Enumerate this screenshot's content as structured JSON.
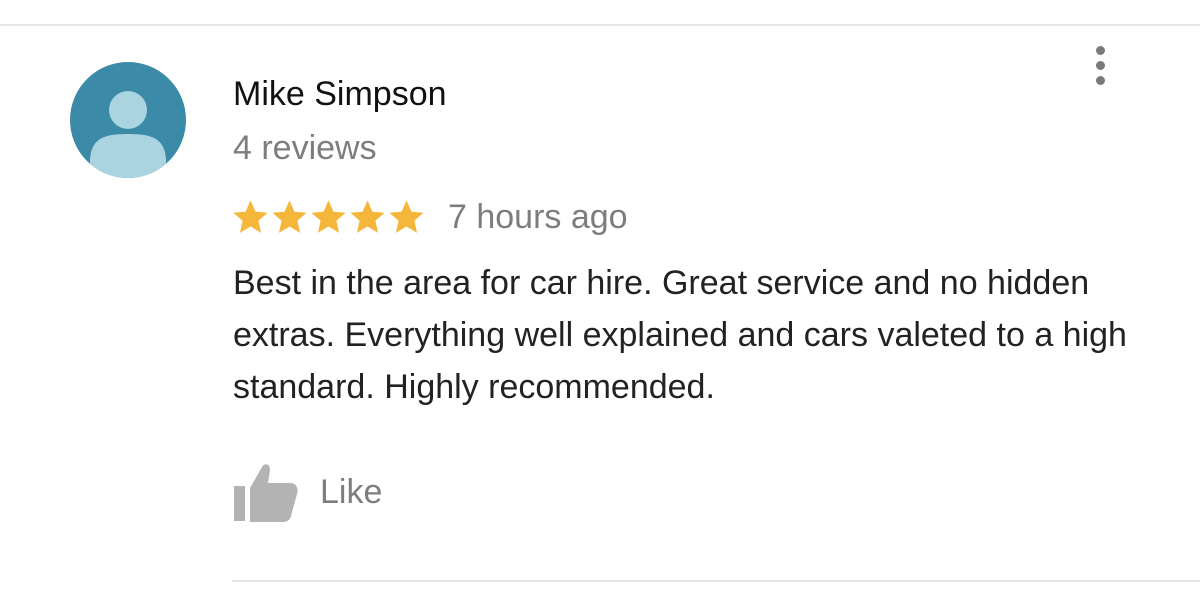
{
  "review": {
    "author": "Mike Simpson",
    "review_count": "4 reviews",
    "rating": 5,
    "rating_max": 5,
    "timestamp": "7 hours ago",
    "text": "Best in the area for car hire. Great service and no hidden extras. Everything well explained and cars valeted to a high standard. Highly recommended.",
    "like_label": "Like"
  },
  "icons": {
    "avatar": "default-person-avatar",
    "menu": "more-vertical-icon",
    "like": "thumbs-up-icon",
    "star": "star-icon"
  },
  "colors": {
    "avatar_bg": "#3b8ba8",
    "avatar_figure": "#a9d4e0",
    "star": "#f4b73c",
    "muted_text": "#7d7d7d",
    "icon_gray": "#b3b3b3"
  }
}
